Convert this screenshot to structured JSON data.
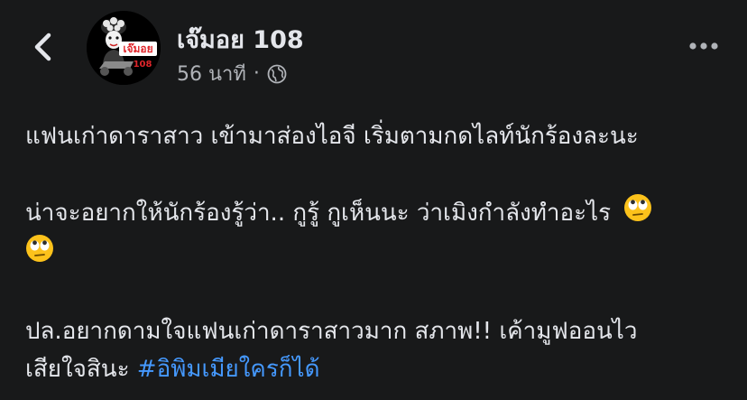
{
  "header": {
    "page_name": "เจ๊มอย 108",
    "time_ago": "56 นาที",
    "separator": "·",
    "privacy_icon": "globe-icon",
    "back_icon": "chevron-left-icon",
    "more_icon": "more-horizontal-icon",
    "avatar": {
      "logo_text": "เจ๊มอย",
      "logo_number": "108",
      "logo_color": "#e0262b"
    }
  },
  "post": {
    "line_1": "แฟนเก่าดาราสาว เข้ามาส่องไอจี เริ่มตามกดไลท์นักร้องละนะ",
    "line_2": "น่าจะอยากให้นักร้องรู้ว่า.. กูรู้ กูเห็นนะ ว่าเมิงกำลังทำอะไร",
    "emoji": "face-with-rolling-eyes",
    "line_3a": "ปล.อยากดามใจแฟนเก่าดาราสาวมาก สภาพ!! เค้ามูฟออนไว",
    "line_3b": "เสียใจสินะ",
    "hashtag": "#อิพิมเมียใครก็ได้"
  },
  "colors": {
    "background": "#18191a",
    "text": "#e4e6eb",
    "secondary_text": "#b0b3b8",
    "link": "#4599ff"
  }
}
